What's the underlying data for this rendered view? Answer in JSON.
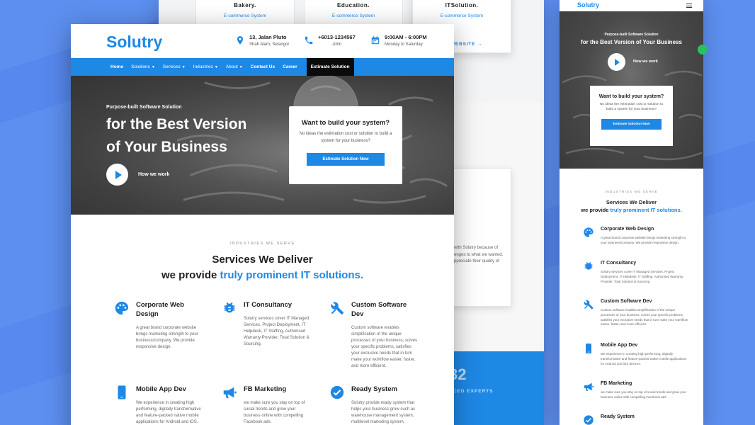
{
  "colors": {
    "accent": "#1e88e5",
    "background": "#5d8ff0",
    "nav_dark": "#0b0b0b"
  },
  "back_page": {
    "cards": [
      {
        "name": "Bakery.",
        "sub": "E-commerce System"
      },
      {
        "name": "Education.",
        "sub": "E-commerce System"
      },
      {
        "name": "ITSolution.",
        "sub": "E-commerce System"
      }
    ],
    "website_link": "WEBSITE →",
    "testimonial": "with Solutry because of\nenges to what we wanted.\nppreciate their quality of",
    "stat_number": "32",
    "stat_label": "NCED EXPERTS"
  },
  "main": {
    "logo": "Solutry",
    "address": {
      "line1": "13, Jalan Pluto",
      "line2": "Shah Alam, Selangor",
      "icon": "location-icon"
    },
    "phone": {
      "line1": "+6013-1234567",
      "line2": "John",
      "icon": "phone-icon"
    },
    "hours": {
      "line1": "9:00AM - 6:00PM",
      "line2": "Monday to Saturday",
      "icon": "calendar-icon"
    },
    "nav": [
      {
        "label": "Home",
        "bold": true,
        "dropdown": false
      },
      {
        "label": "Solutions",
        "bold": false,
        "dropdown": true
      },
      {
        "label": "Services",
        "bold": false,
        "dropdown": true
      },
      {
        "label": "Industries",
        "bold": false,
        "dropdown": true
      },
      {
        "label": "About",
        "bold": false,
        "dropdown": true
      },
      {
        "label": "Contact Us",
        "bold": true,
        "dropdown": false
      },
      {
        "label": "Career",
        "bold": true,
        "dropdown": false
      }
    ],
    "nav_cta": "Estimate Solution",
    "hero": {
      "kicker": "Purpose-built Software Solution",
      "title_line1": "for the Best Version",
      "title_line2": "of Your Business",
      "how": "How we work",
      "card_title": "Want to build your system?",
      "card_text": "No ideas the estimation cost or solution to build a system for your business?",
      "card_button": "Estimate Solution Now"
    },
    "services": {
      "kicker": "INDUSTRIES WE SERVE",
      "heading": "Services We Deliver",
      "sub_prefix": "we provide ",
      "sub_accent": "truly prominent IT solutions.",
      "items": [
        {
          "title": "Corporate Web Design",
          "icon": "palette-icon",
          "desc": "A great brand corporate website brings marketing strength to your business/company. We provide responsive design."
        },
        {
          "title": "IT Consultancy",
          "icon": "bug-icon",
          "desc": "Solutry services cover IT Managed Services, Project Deployment, IT Helpdesk, IT Staffing, Authorised Warranty Provider, Total Solution & Sourcing."
        },
        {
          "title": "Custom Software Dev",
          "icon": "tools-icon",
          "desc": "Custom software enables simplification of the unique processes of your business, solves your specific problems, satisfies your exclusive needs that in turn make your workflow easier, faster, and more efficient."
        },
        {
          "title": "Mobile App Dev",
          "icon": "mobile-icon",
          "desc": "We experience in creating high performing, digitally transformative and feature-packed native mobile applications for Android and iOS."
        },
        {
          "title": "FB Marketing",
          "icon": "megaphone-icon",
          "desc": "we make sure you stay on top of social trends and grow your business online with compelling Facebook ads."
        },
        {
          "title": "Ready System",
          "icon": "check-circle-icon",
          "desc": "Solutry provide ready system that helps your business grow such as warehouse management system, multilevel marketing system,"
        }
      ]
    }
  },
  "mobile": {
    "logo": "Solutry",
    "hero_kicker": "Purpose-built Software Solution",
    "hero_title": "for the Best Version of Your Business",
    "how": "How we work",
    "card_title": "Want to build your system?",
    "card_text": "No ideas the estimation cost or solution to build a system for your business?",
    "card_button": "Estimate Solution Now",
    "kicker": "INDUSTRIES WE SERVE",
    "heading": "Services We Deliver",
    "sub_prefix": "we provide ",
    "sub_accent": "truly prominent IT solutions.",
    "items": [
      {
        "title": "Corporate Web Design",
        "desc": "A great brand corporate website brings marketing strength to your business/company. We provide responsive design."
      },
      {
        "title": "IT Consultancy",
        "desc": "Solutry services cover IT Managed Services, Project Deployment, IT Helpdesk, IT Staffing, Authorised Warranty Provider, Total Solution & Sourcing."
      },
      {
        "title": "Custom Software Dev",
        "desc": "Custom software enables simplification of the unique processes of your business, solves your specific problems, satisfies your exclusive needs that in turn make your workflow easier, faster, and more efficient."
      },
      {
        "title": "Mobile App Dev",
        "desc": "We experience in creating high performing, digitally transformative and feature-packed native mobile applications for Android and iOS devices."
      },
      {
        "title": "FB Marketing",
        "desc": "we make sure you stay on top of social trends and grow your business online with compelling Facebook ads."
      },
      {
        "title": "Ready System",
        "desc": ""
      }
    ]
  }
}
